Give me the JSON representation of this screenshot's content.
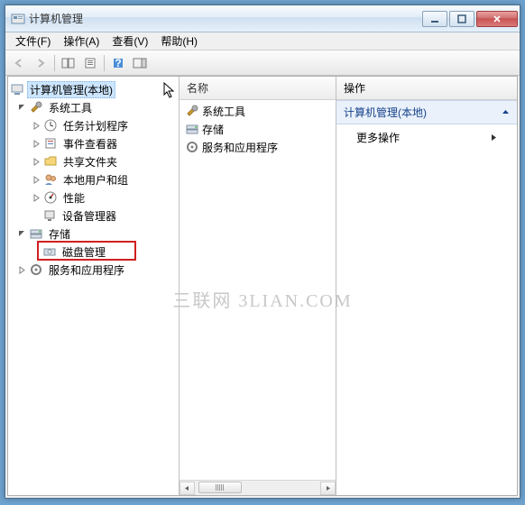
{
  "window": {
    "title": "计算机管理"
  },
  "menu": {
    "file": "文件(F)",
    "action": "操作(A)",
    "view": "查看(V)",
    "help": "帮助(H)"
  },
  "columns": {
    "name": "名称",
    "actions": "操作"
  },
  "tree": {
    "root": "计算机管理(本地)",
    "systools": "系统工具",
    "scheduler": "任务计划程序",
    "eventviewer": "事件查看器",
    "shared": "共享文件夹",
    "users": "本地用户和组",
    "perf": "性能",
    "devmgr": "设备管理器",
    "storage": "存储",
    "diskmgmt": "磁盘管理",
    "services": "服务和应用程序"
  },
  "list": {
    "systools": "系统工具",
    "storage": "存储",
    "services": "服务和应用程序"
  },
  "actions": {
    "section": "计算机管理(本地)",
    "more": "更多操作"
  },
  "watermark": "三联网 3LIAN.COM"
}
